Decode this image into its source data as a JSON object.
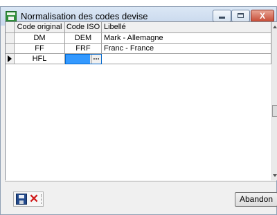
{
  "window": {
    "title": "Normalisation des codes devise",
    "controls": {
      "minimize_icon": "minimize-icon",
      "maximize_icon": "maximize-icon",
      "close_icon": "close-icon",
      "close_glyph": "X"
    }
  },
  "table": {
    "columns": [
      "Code original",
      "Code ISO",
      "Libellé"
    ],
    "rows": [
      {
        "original": "DM",
        "iso": "DEM",
        "label": "Mark - Allemagne"
      },
      {
        "original": "FF",
        "iso": "FRF",
        "label": "Franc - France"
      },
      {
        "original": "HFL",
        "iso": "",
        "label": ""
      }
    ],
    "current_row_index": 2,
    "editing_cell": "iso",
    "ellipsis": "..."
  },
  "footer": {
    "save_icon": "save-icon",
    "cancel_icon": "cancel-icon",
    "cancel_glyph": "✕",
    "abandon_label": "Abandon"
  }
}
